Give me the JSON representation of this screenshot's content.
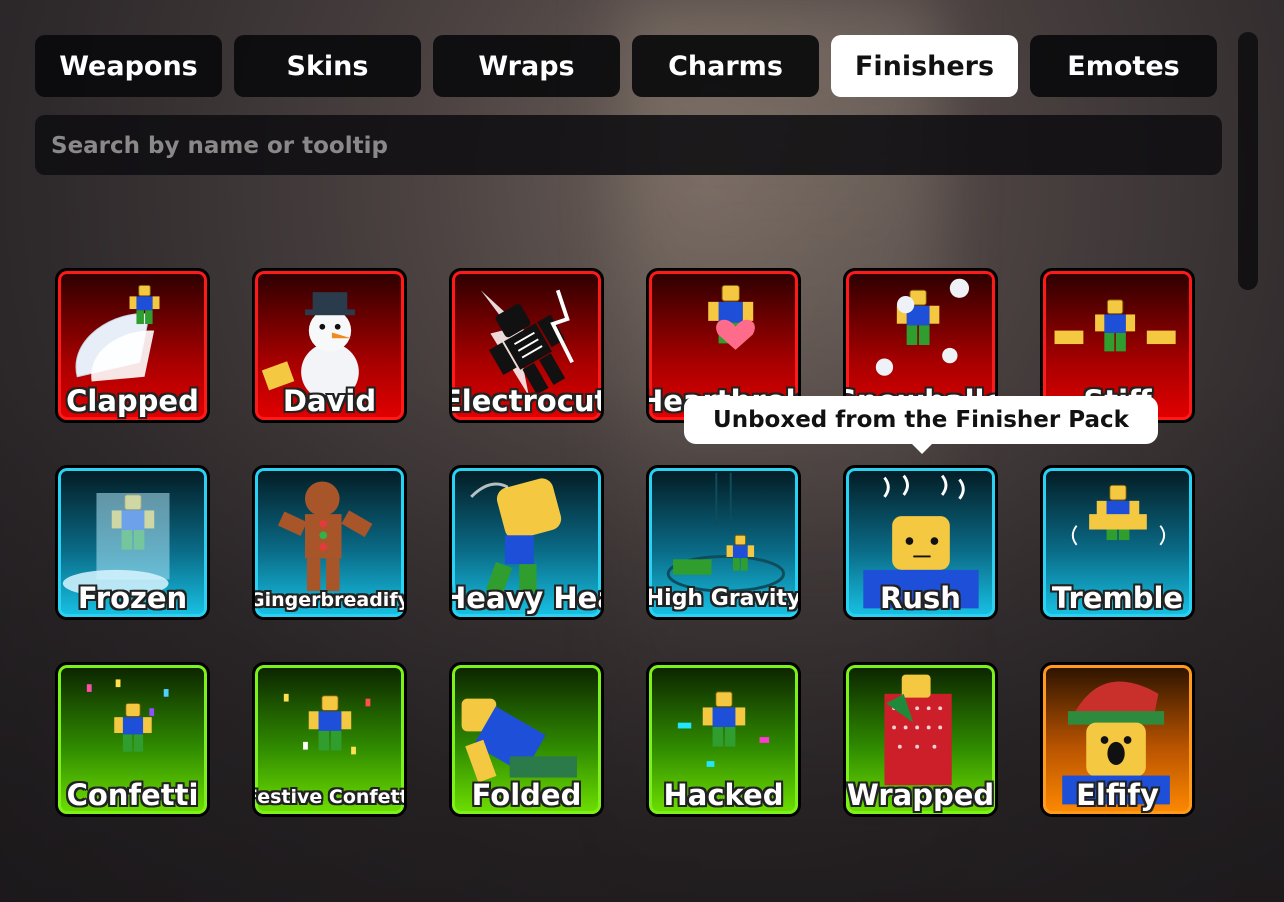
{
  "tabs": [
    {
      "label": "Weapons",
      "active": false
    },
    {
      "label": "Skins",
      "active": false
    },
    {
      "label": "Wraps",
      "active": false
    },
    {
      "label": "Charms",
      "active": false
    },
    {
      "label": "Finishers",
      "active": true
    },
    {
      "label": "Emotes",
      "active": false
    }
  ],
  "search": {
    "placeholder": "Search by name or tooltip",
    "value": ""
  },
  "tooltip": {
    "text": "Unboxed from the Finisher Pack"
  },
  "finishers": [
    {
      "name": "Clapped",
      "rarity": "red",
      "icon": "clapped-icon"
    },
    {
      "name": "David",
      "rarity": "red",
      "icon": "snowman-icon"
    },
    {
      "name": "Electrocute",
      "rarity": "red",
      "icon": "electrocute-icon"
    },
    {
      "name": "Heartbroken",
      "rarity": "red",
      "icon": "heart-icon"
    },
    {
      "name": "Snowballed",
      "rarity": "red",
      "icon": "snowball-icon"
    },
    {
      "name": "Stiff",
      "rarity": "red",
      "icon": "stiff-icon"
    },
    {
      "name": "Frozen",
      "rarity": "blue",
      "icon": "frozen-icon"
    },
    {
      "name": "Gingerbreadify",
      "rarity": "blue",
      "icon": "gingerbread-icon"
    },
    {
      "name": "Heavy Head",
      "rarity": "blue",
      "icon": "heavy-head-icon"
    },
    {
      "name": "High Gravity",
      "rarity": "blue",
      "icon": "high-gravity-icon"
    },
    {
      "name": "Rush",
      "rarity": "blue",
      "icon": "rush-icon"
    },
    {
      "name": "Tremble",
      "rarity": "blue",
      "icon": "tremble-icon"
    },
    {
      "name": "Confetti",
      "rarity": "green",
      "icon": "confetti-icon"
    },
    {
      "name": "Festive Confetti",
      "rarity": "green",
      "icon": "festive-confetti-icon"
    },
    {
      "name": "Folded",
      "rarity": "green",
      "icon": "folded-icon"
    },
    {
      "name": "Hacked",
      "rarity": "green",
      "icon": "hacked-icon"
    },
    {
      "name": "Wrapped",
      "rarity": "green",
      "icon": "wrapped-icon"
    },
    {
      "name": "Elfify",
      "rarity": "orange",
      "icon": "elf-icon"
    }
  ],
  "colors": {
    "red": "#ff1a1a",
    "blue": "#29d2f2",
    "green": "#7cf21a",
    "orange": "#ff9a1a",
    "skin": "#f5c842",
    "shirt": "#1d4fd8",
    "pants": "#2f9e2f"
  }
}
